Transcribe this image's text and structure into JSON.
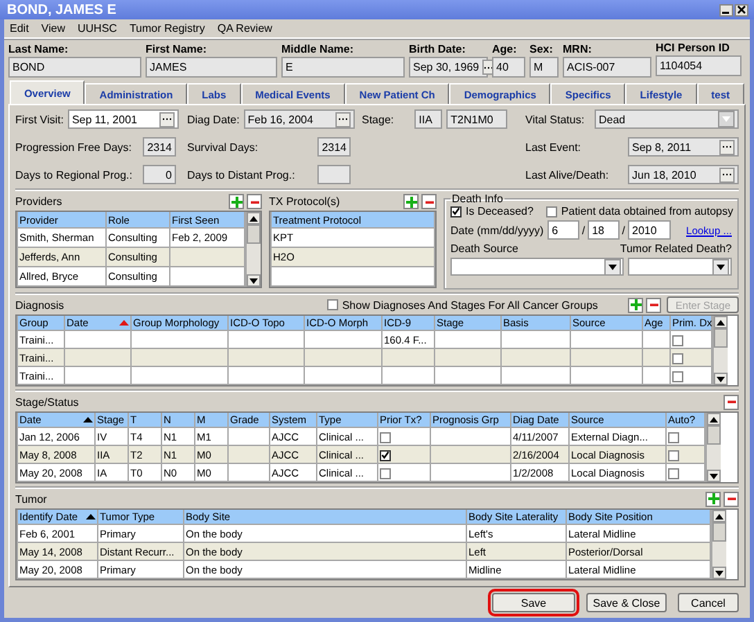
{
  "window": {
    "title": "BOND, JAMES E"
  },
  "menu": [
    "Edit",
    "View",
    "UUHSC",
    "Tumor Registry",
    "QA Review"
  ],
  "patient": [
    {
      "label": "Last Name:",
      "value": "BOND",
      "kind": "text"
    },
    {
      "label": "First Name:",
      "value": "JAMES",
      "kind": "text"
    },
    {
      "label": "Middle Name:",
      "value": "E",
      "kind": "text"
    },
    {
      "label": "Birth Date:",
      "value": "Sep 30, 1969",
      "kind": "date"
    },
    {
      "label": "Age:",
      "value": "40",
      "kind": "text"
    },
    {
      "label": "Sex:",
      "value": "M",
      "kind": "text"
    },
    {
      "label": "MRN:",
      "value": "ACIS-007",
      "kind": "text"
    },
    {
      "label": "HCI Person ID",
      "value": "1104054",
      "kind": "text"
    }
  ],
  "tabs": [
    {
      "label": "Overview",
      "selected": true
    },
    {
      "label": "Administration",
      "selected": false
    },
    {
      "label": "Labs",
      "selected": false
    },
    {
      "label": "Medical Events",
      "selected": false
    },
    {
      "label": "New Patient Ch",
      "selected": false
    },
    {
      "label": "Demographics",
      "selected": false
    },
    {
      "label": "Specifics",
      "selected": false
    },
    {
      "label": "Lifestyle",
      "selected": false
    },
    {
      "label": "test",
      "selected": false
    }
  ],
  "overview": {
    "rows": [
      [
        {
          "label": "First Visit:",
          "kind": "date",
          "value": "Sep 11, 2001",
          "editable": true
        },
        {
          "label": "Diag Date:",
          "kind": "date",
          "value": "Feb 16, 2004",
          "editable": false
        },
        {
          "label": "Stage:",
          "kind": "stage",
          "values": [
            "IIA",
            "T2N1M0"
          ]
        },
        {
          "label": "Vital Status:",
          "kind": "select",
          "value": "Dead"
        }
      ],
      [
        {
          "label": "Progression Free Days:",
          "kind": "number",
          "value": "2314"
        },
        {
          "label": "Survival Days:",
          "kind": "number",
          "value": "2314"
        },
        {
          "label": "Last Event:",
          "kind": "date",
          "value": "Sep 8, 2011",
          "editable": false
        }
      ],
      [
        {
          "label": "Days to Regional Prog.:",
          "kind": "number",
          "value": "0"
        },
        {
          "label": "Days to Distant Prog.:",
          "kind": "number"
        },
        {
          "label": "Last Alive/Death:",
          "kind": "date",
          "value": "Jun 18, 2010",
          "editable": false
        }
      ]
    ]
  },
  "providers": {
    "title": "Providers",
    "actions": [
      {
        "kind": "add"
      },
      {
        "kind": "remove"
      }
    ],
    "columns": [
      {
        "label": "Provider"
      },
      {
        "label": "Role"
      },
      {
        "label": "First Seen"
      }
    ],
    "rows": [
      [
        "Smith, Sherman",
        "Consulting",
        "Feb 2, 2009"
      ],
      [
        "Jefferds, Ann",
        "Consulting",
        null
      ],
      [
        "Allred, Bryce",
        "Consulting",
        null
      ]
    ]
  },
  "tx_protocols": {
    "title": "TX Protocol(s)",
    "actions": [
      {
        "kind": "add"
      },
      {
        "kind": "remove"
      }
    ],
    "columns": [
      {
        "label": "Treatment Protocol"
      }
    ],
    "rows": [
      [
        "KPT"
      ],
      [
        "H2O"
      ]
    ]
  },
  "death_info": {
    "title": "Death Info",
    "checkboxes": [
      {
        "label": "Is Deceased?",
        "checked": true
      },
      {
        "label": "Patient data obtained from autopsy",
        "checked": false
      }
    ],
    "date_label": "Date (mm/dd/yyyy)",
    "date_parts": [
      "6",
      "18",
      "2010"
    ],
    "separator": "/",
    "lookup": "Lookup ...",
    "death_source_label": "Death Source",
    "tumor_related_label": "Tumor Related Death?"
  },
  "diagnosis": {
    "title": "Diagnosis",
    "show_all": {
      "label": "Show Diagnoses And Stages For All Cancer Groups",
      "checked": false
    },
    "actions": [
      {
        "kind": "add"
      },
      {
        "kind": "remove"
      }
    ],
    "enter_stage": {
      "label": "Enter Stage",
      "disabled": true
    },
    "columns": [
      {
        "label": "Group",
        "sorted": false
      },
      {
        "label": "Date",
        "sorted": true
      },
      {
        "label": "Group Morphology",
        "sorted": false
      },
      {
        "label": "ICD-O Topo",
        "sorted": false
      },
      {
        "label": "ICD-O Morph",
        "sorted": false
      },
      {
        "label": "ICD-9",
        "sorted": false
      },
      {
        "label": "Stage",
        "sorted": false
      },
      {
        "label": "Basis",
        "sorted": false
      },
      {
        "label": "Source",
        "sorted": false
      },
      {
        "label": "Age",
        "sorted": false
      },
      {
        "label": "Prim. Dx",
        "sorted": false,
        "kind": "check"
      }
    ],
    "rows": [
      [
        "Traini...",
        null,
        null,
        null,
        null,
        "160.4 F...",
        null,
        null,
        null,
        null,
        false
      ],
      [
        "Traini...",
        null,
        null,
        null,
        null,
        null,
        null,
        null,
        null,
        null,
        false
      ],
      [
        "Traini...",
        null,
        null,
        null,
        null,
        null,
        null,
        null,
        null,
        null,
        false
      ]
    ]
  },
  "stage_status": {
    "title": "Stage/Status",
    "actions": [
      {
        "kind": "remove"
      }
    ],
    "columns": [
      {
        "label": "Date",
        "sorted": true
      },
      {
        "label": "Stage",
        "sorted": false
      },
      {
        "label": "T",
        "sorted": false
      },
      {
        "label": "N",
        "sorted": false
      },
      {
        "label": "M",
        "sorted": false
      },
      {
        "label": "Grade",
        "sorted": false
      },
      {
        "label": "System",
        "sorted": false
      },
      {
        "label": "Type",
        "sorted": false
      },
      {
        "label": "Prior Tx?",
        "sorted": false,
        "kind": "check"
      },
      {
        "label": "Prognosis Grp",
        "sorted": false
      },
      {
        "label": "Diag Date",
        "sorted": false
      },
      {
        "label": "Source",
        "sorted": false
      },
      {
        "label": "Auto?",
        "sorted": false,
        "kind": "check"
      }
    ],
    "rows": [
      [
        "Jan 12, 2006",
        "IV",
        "T4",
        "N1",
        "M1",
        null,
        "AJCC",
        "Clinical ...",
        false,
        null,
        "4/11/2007",
        "External Diagn...",
        false
      ],
      [
        "May 8, 2008",
        "IIA",
        "T2",
        "N1",
        "M0",
        null,
        "AJCC",
        "Clinical ...",
        true,
        null,
        "2/16/2004",
        "Local Diagnosis",
        false
      ],
      [
        "May 20, 2008",
        "IA",
        "T0",
        "N0",
        "M0",
        null,
        "AJCC",
        "Clinical ...",
        false,
        null,
        "1/2/2008",
        "Local Diagnosis",
        false
      ]
    ]
  },
  "tumor": {
    "title": "Tumor",
    "actions": [
      {
        "kind": "add"
      },
      {
        "kind": "remove"
      }
    ],
    "columns": [
      {
        "label": "Identify Date",
        "sorted": true
      },
      {
        "label": "Tumor Type",
        "sorted": false
      },
      {
        "label": "Body Site",
        "sorted": false
      },
      {
        "label": "Body Site Laterality",
        "sorted": false
      },
      {
        "label": "Body Site Position",
        "sorted": false
      }
    ],
    "rows": [
      [
        "Feb 6, 2001",
        "Primary",
        "On the body",
        "Left's",
        "Lateral Midline"
      ],
      [
        "May 14, 2008",
        "Distant Recurr...",
        "On the body",
        "Left",
        "Posterior/Dorsal"
      ],
      [
        "May 20, 2008",
        "Primary",
        "On the body",
        "Midline",
        "Lateral Midline"
      ]
    ]
  },
  "buttons": [
    {
      "label": "Save",
      "highlighted": true
    },
    {
      "label": "Save & Close",
      "highlighted": false
    },
    {
      "label": "Cancel",
      "highlighted": false
    }
  ]
}
